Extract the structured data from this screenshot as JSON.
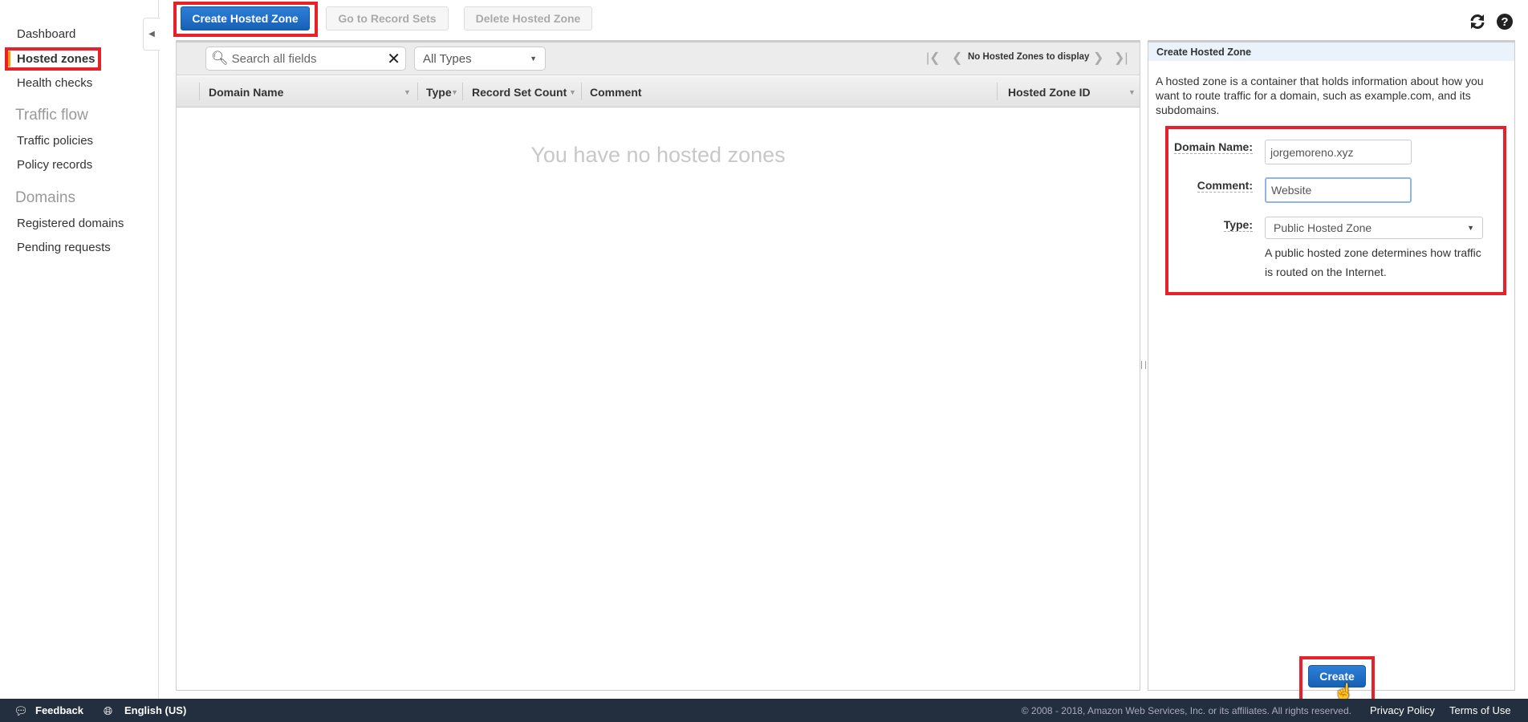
{
  "sidebar": {
    "items": [
      {
        "label": "Dashboard"
      },
      {
        "label": "Hosted zones",
        "active": true
      },
      {
        "label": "Health checks"
      }
    ],
    "sections": [
      {
        "heading": "Traffic flow",
        "items": [
          {
            "label": "Traffic policies"
          },
          {
            "label": "Policy records"
          }
        ]
      },
      {
        "heading": "Domains",
        "items": [
          {
            "label": "Registered domains"
          },
          {
            "label": "Pending requests"
          }
        ]
      }
    ]
  },
  "toolbar": {
    "create_label": "Create Hosted Zone",
    "goto_label": "Go to Record Sets",
    "delete_label": "Delete Hosted Zone"
  },
  "table": {
    "search_placeholder": "Search all fields",
    "type_filter": "All Types",
    "pagination": "No Hosted Zones to display",
    "columns": [
      "Domain Name",
      "Type",
      "Record Set Count",
      "Comment",
      "Hosted Zone ID"
    ],
    "empty_message": "You have no hosted zones"
  },
  "panel": {
    "title": "Create Hosted Zone",
    "description": "A hosted zone is a container that holds information about how you want to route traffic for a domain, such as example.com, and its subdomains.",
    "domain_label": "Domain Name:",
    "domain_value": "jorgemoreno.xyz",
    "comment_label": "Comment:",
    "comment_value": "Website",
    "type_label": "Type:",
    "type_value": "Public Hosted Zone",
    "type_help": "A public hosted zone determines how traffic is routed on the Internet.",
    "create_label": "Create"
  },
  "footer": {
    "feedback": "Feedback",
    "language": "English (US)",
    "copyright": "© 2008 - 2018, Amazon Web Services, Inc. or its affiliates. All rights reserved.",
    "privacy": "Privacy Policy",
    "terms": "Terms of Use"
  },
  "colors": {
    "primary": "#1a6bc4",
    "highlight": "#e8202a",
    "footer": "#232f3e",
    "active_marker": "#f90"
  }
}
